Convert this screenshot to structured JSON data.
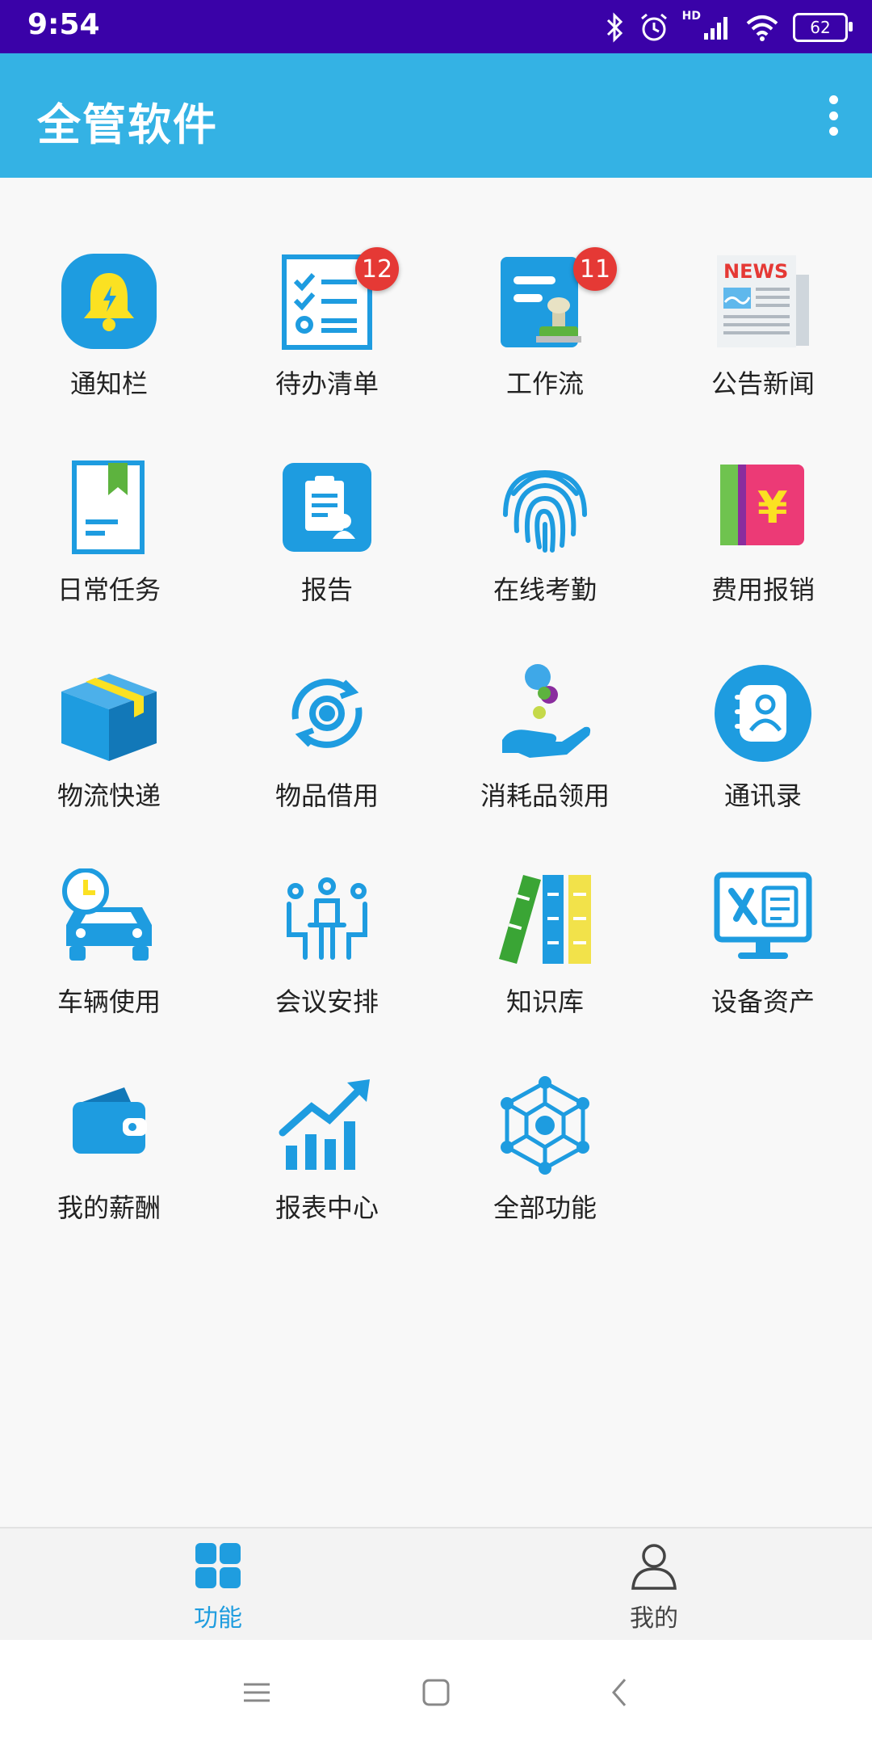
{
  "status_bar": {
    "time": "9:54",
    "battery": "62",
    "network": "HD"
  },
  "app_bar": {
    "title": "全管软件"
  },
  "colors": {
    "brand": "#34b2e4",
    "status_bar": "#3a02a8",
    "icon_blue": "#1e9ce0",
    "badge": "#e53935",
    "active_tab": "#1f9ddf",
    "inactive_tab": "#444444"
  },
  "grid": [
    {
      "label": "通知栏",
      "icon": "bell-icon"
    },
    {
      "label": "待办清单",
      "icon": "checklist-icon",
      "badge": "12"
    },
    {
      "label": "工作流",
      "icon": "workflow-stamp-icon",
      "badge": "11"
    },
    {
      "label": "公告新闻",
      "icon": "newspaper-icon",
      "news_text": "NEWS"
    },
    {
      "label": "日常任务",
      "icon": "bookmark-document-icon"
    },
    {
      "label": "报告",
      "icon": "clipboard-report-icon"
    },
    {
      "label": "在线考勤",
      "icon": "fingerprint-icon"
    },
    {
      "label": "费用报销",
      "icon": "yuan-ticket-icon",
      "currency": "¥"
    },
    {
      "label": "物流快递",
      "icon": "package-box-icon"
    },
    {
      "label": "物品借用",
      "icon": "gear-cycle-icon"
    },
    {
      "label": "消耗品领用",
      "icon": "hand-receive-icon"
    },
    {
      "label": "通讯录",
      "icon": "contacts-book-icon"
    },
    {
      "label": "车辆使用",
      "icon": "car-clock-icon"
    },
    {
      "label": "会议安排",
      "icon": "meeting-icon"
    },
    {
      "label": "知识库",
      "icon": "books-icon"
    },
    {
      "label": "设备资产",
      "icon": "equipment-monitor-icon"
    },
    {
      "label": "我的薪酬",
      "icon": "wallet-icon"
    },
    {
      "label": "报表中心",
      "icon": "growth-chart-icon"
    },
    {
      "label": "全部功能",
      "icon": "network-cube-icon"
    }
  ],
  "bottom_nav": [
    {
      "label": "功能",
      "icon": "grid-apps-icon",
      "active": true
    },
    {
      "label": "我的",
      "icon": "person-icon",
      "active": false
    }
  ]
}
